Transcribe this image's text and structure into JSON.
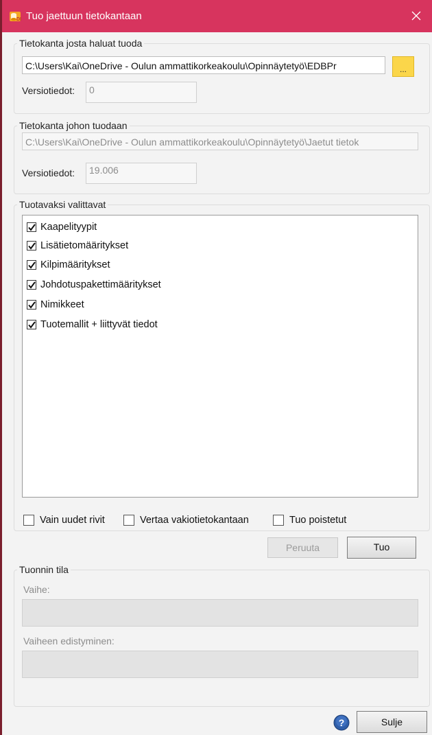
{
  "window": {
    "title": "Tuo jaettuun tietokantaan",
    "accent_color": "#d7345e",
    "icon": "database-app-icon"
  },
  "source_group": {
    "legend": "Tietokanta josta haluat tuoda",
    "path_value": "C:\\Users\\Kai\\OneDrive - Oulun ammattikorkeakoulu\\Opinnäytetyö\\EDBPr",
    "browse_label": "...",
    "version_label": "Versiotiedot:",
    "version_value": "0"
  },
  "target_group": {
    "legend": "Tietokanta johon tuodaan",
    "path_value": "C:\\Users\\Kai\\OneDrive - Oulun ammattikorkeakoulu\\Opinnäytetyö\\Jaetut tietok",
    "version_label": "Versiotiedot:",
    "version_value": "19.006"
  },
  "items_group": {
    "legend": "Tuotavaksi valittavat",
    "items": [
      {
        "label": "Kaapelityypit",
        "checked": true
      },
      {
        "label": "Lisätietomääritykset",
        "checked": true
      },
      {
        "label": "Kilpimääritykset",
        "checked": true
      },
      {
        "label": "Johdotuspakettimääritykset",
        "checked": true
      },
      {
        "label": "Nimikkeet",
        "checked": true
      },
      {
        "label": "Tuotemallit + liittyvät tiedot",
        "checked": true
      }
    ],
    "options": [
      {
        "label": "Vain uudet rivit",
        "checked": false
      },
      {
        "label": "Vertaa vakiotietokantaan",
        "checked": false
      },
      {
        "label": "Tuo poistetut",
        "checked": false
      }
    ]
  },
  "actions": {
    "cancel_label": "Peruuta",
    "import_label": "Tuo"
  },
  "status_group": {
    "legend": "Tuonnin tila",
    "phase_label": "Vaihe:",
    "phase_progress_label": "Vaiheen edistyminen:"
  },
  "footer": {
    "help_icon": "help-icon",
    "close_label": "Sulje"
  }
}
